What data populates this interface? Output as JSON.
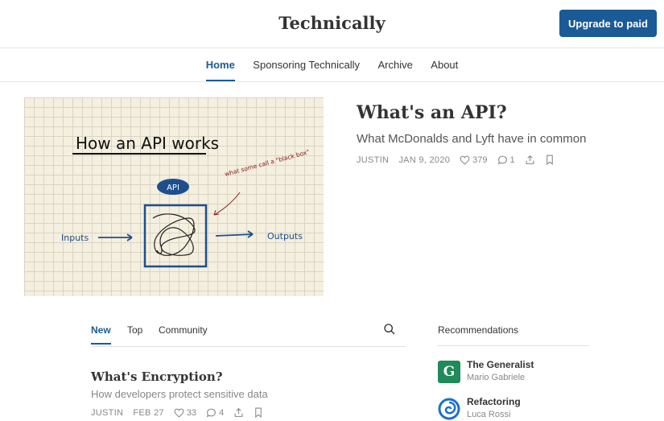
{
  "header": {
    "site_title": "Technically",
    "upgrade_label": "Upgrade to paid"
  },
  "nav": {
    "items": [
      "Home",
      "Sponsoring Technically",
      "Archive",
      "About"
    ],
    "active": "Home"
  },
  "hero": {
    "title": "What's an API?",
    "subtitle": "What McDonalds and Lyft have in common",
    "author": "JUSTIN",
    "date": "JAN 9, 2020",
    "likes": "379",
    "comments": "1",
    "image": {
      "heading": "How an API works",
      "api_label": "API",
      "note": "what some call a \"black box\"",
      "inputs_label": "Inputs",
      "outputs_label": "Outputs"
    }
  },
  "feed": {
    "tabs": [
      "New",
      "Top",
      "Community"
    ],
    "active_tab": "New",
    "posts": [
      {
        "title": "What's Encryption?",
        "subtitle": "How developers protect sensitive data",
        "author": "JUSTIN",
        "date": "FEB 27",
        "likes": "33",
        "comments": "4"
      }
    ]
  },
  "recommendations": {
    "heading": "Recommendations",
    "items": [
      {
        "name": "The Generalist",
        "author": "Mario Gabriele",
        "logo_letter": "G",
        "logo_color": "#1f8a5a"
      },
      {
        "name": "Refactoring",
        "author": "Luca Rossi",
        "logo_color": "#1a6fd1"
      }
    ]
  },
  "colors": {
    "accent": "#1a5a96",
    "meta_text": "#888888"
  }
}
